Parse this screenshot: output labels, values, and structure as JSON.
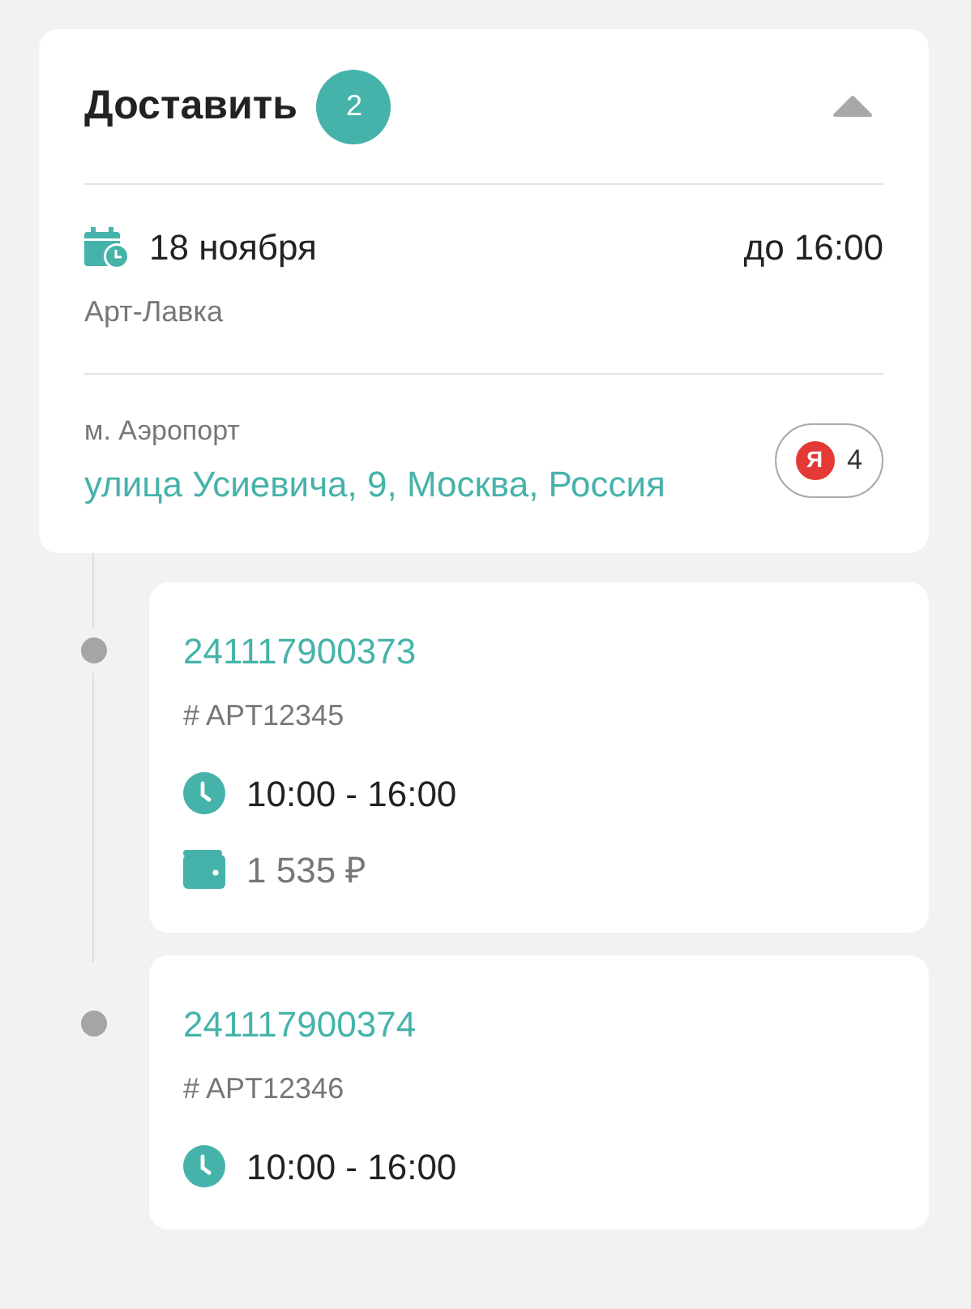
{
  "header": {
    "title": "Доставить",
    "count": "2",
    "expanded": true
  },
  "date": {
    "day": "18 ноября",
    "deadline": "до 16:00",
    "shop": "Арт-Лавка"
  },
  "address": {
    "metro": "м. Аэропорт",
    "street": "улица Усиевича, 9, Москва, Россия",
    "taxi_count": "4",
    "taxi_logo": "Я"
  },
  "orders": [
    {
      "number": "241117900373",
      "article": "# APT12345",
      "time": "10:00 - 16:00",
      "price": "1 535 ₽"
    },
    {
      "number": "241117900374",
      "article": "# APT12346",
      "time": "10:00 - 16:00"
    }
  ]
}
